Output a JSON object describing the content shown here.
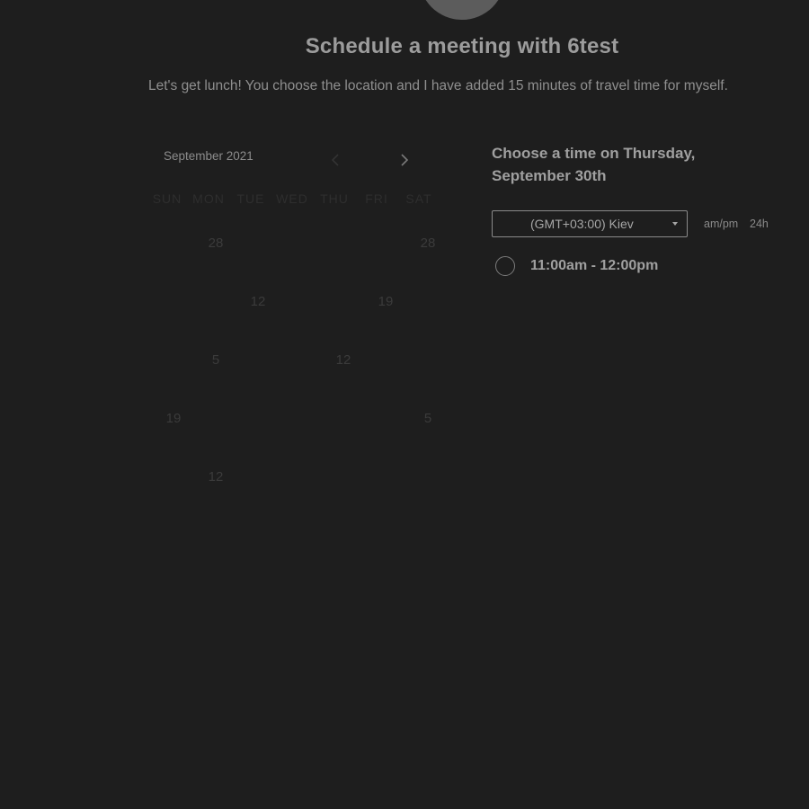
{
  "header": {
    "title": "Schedule a meeting with 6test",
    "description": "Let's get lunch! You choose the location and I have added 15 minutes of travel time for myself."
  },
  "calendar": {
    "month_label": "September 2021",
    "prev_icon": "chevron-left-icon",
    "next_icon": "chevron-right-icon",
    "weekdays": [
      "SUN",
      "MON",
      "TUE",
      "WED",
      "THU",
      "FRI",
      "SAT"
    ],
    "visible_days": [
      "28",
      "28",
      "12",
      "19",
      "5",
      "12",
      "19",
      "5",
      "12"
    ]
  },
  "time_panel": {
    "heading": "Choose a time on Thursday, September 30th",
    "timezone": "(GMT+03:00) Kiev",
    "format_ampm": "am/pm",
    "format_24h": "24h",
    "slots": [
      {
        "label": "11:00am - 12:00pm"
      }
    ]
  },
  "colors": {
    "background": "#1e1e1e",
    "text": "#9c9c9c"
  }
}
